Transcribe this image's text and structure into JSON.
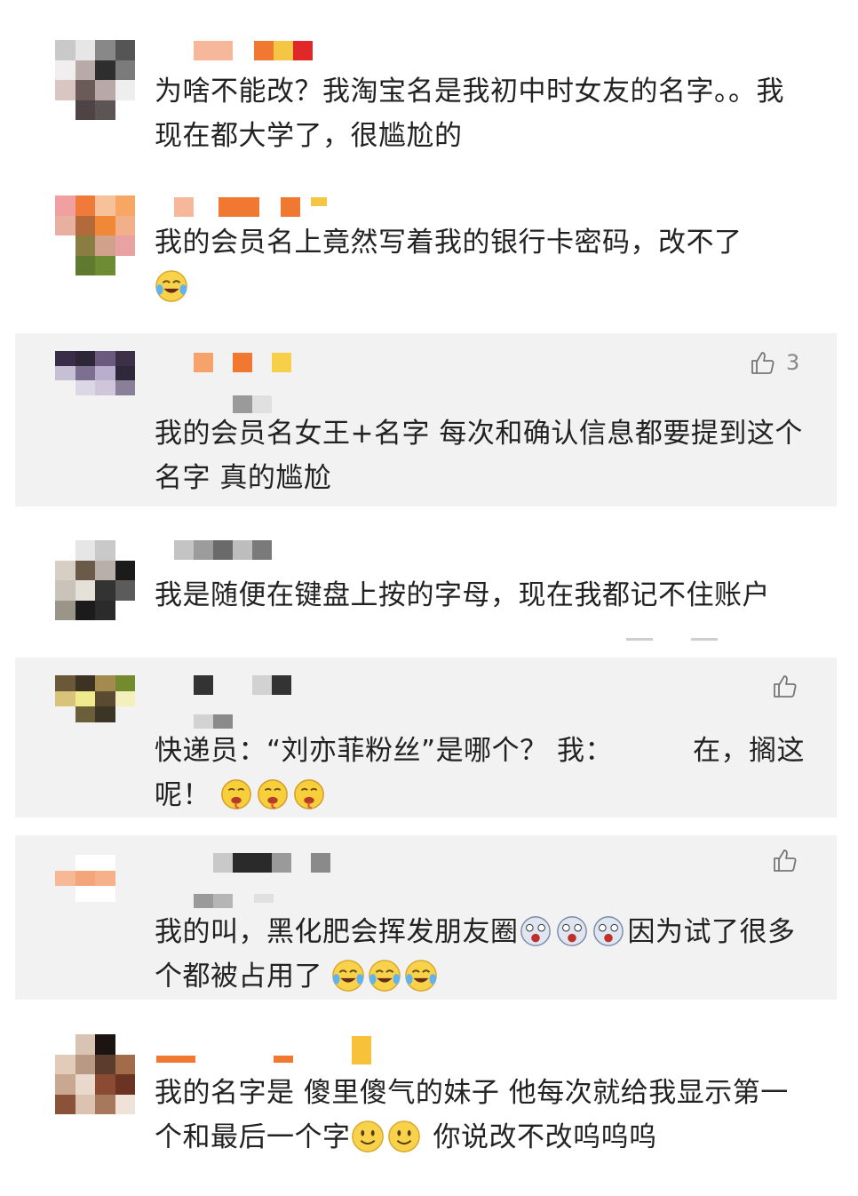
{
  "comments": [
    {
      "text": "为啥不能改？我淘宝名是我初中时女友的名字。。我现在都大学了，很尴尬的"
    },
    {
      "text": "我的会员名上竟然写着我的银行卡密码，改不了",
      "emoji": [
        "laugh-cry-emoji"
      ]
    },
    {
      "text": "我的会员名女王+名字 每次和确认信息都要提到这个名字 真的尴尬",
      "likes": "3"
    },
    {
      "text": "我是随便在键盘上按的字母，现在我都记不住账户"
    },
    {
      "text_before": "快递员：“刘亦菲粉丝”是哪个？ 我：",
      "text_after": "在，搁这呢！",
      "emoji": [
        "drool-emoji",
        "drool-emoji",
        "drool-emoji"
      ]
    },
    {
      "text_before": "我的叫，黑化肥会挥发朋友圈",
      "text_after": "因为试了很多个都被占用了",
      "emoji_mid": [
        "shock-emoji",
        "shock-emoji",
        "shock-emoji"
      ],
      "emoji": [
        "laugh-cry-emoji",
        "laugh-cry-emoji",
        "laugh-cry-emoji"
      ]
    },
    {
      "text_before": "我的名字是 傻里傻气的妹子 他每次就给我显示第一个和最后一个字",
      "text_after": "你说改不改呜呜呜",
      "emoji_mid": [
        "smile-emoji",
        "smile-emoji"
      ]
    }
  ]
}
